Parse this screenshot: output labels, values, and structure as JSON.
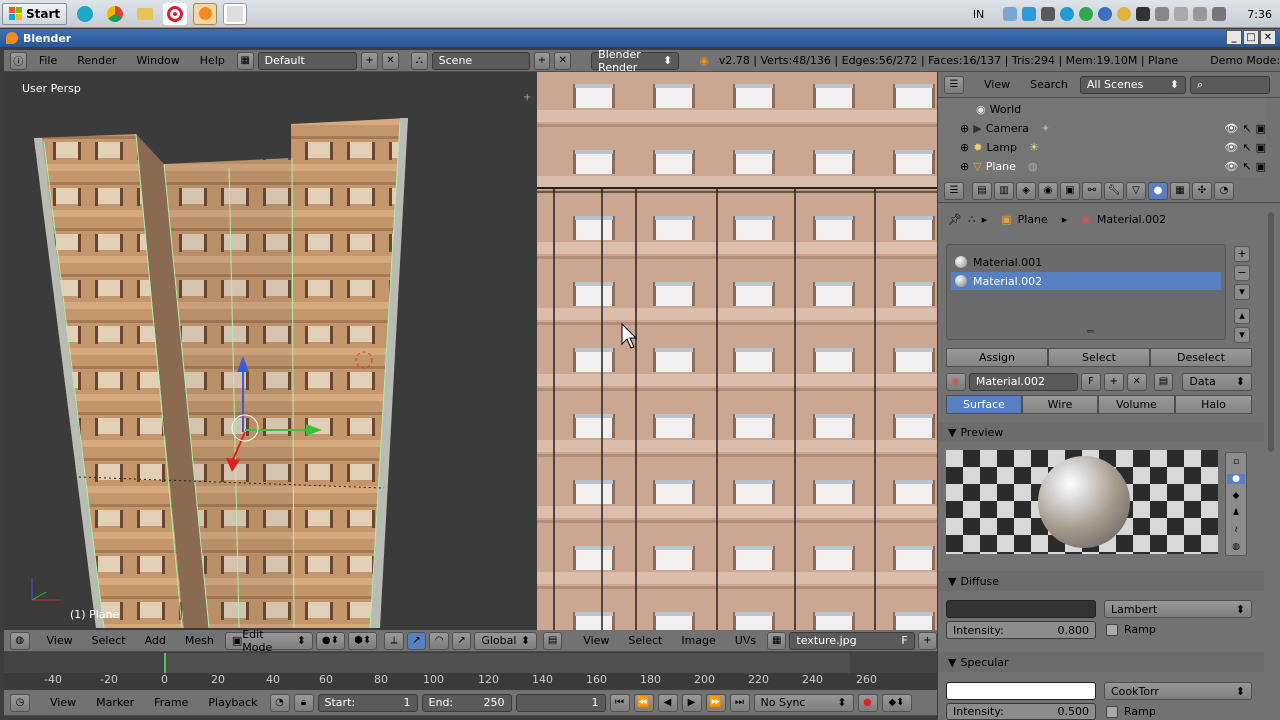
{
  "taskbar": {
    "start_label": "Start",
    "apps": [
      "chrome-icon",
      "chrome-icon",
      "folder-icon",
      "opera-icon",
      "blender-icon",
      "window-icon"
    ],
    "lang": "IN",
    "clock": "7:36"
  },
  "window": {
    "title": "Blender"
  },
  "top_header": {
    "menus": [
      "File",
      "Render",
      "Window",
      "Help"
    ],
    "layout": "Default",
    "scene": "Scene",
    "engine": "Blender Render",
    "stats": "v2.78 | Verts:48/136 | Edges:56/272 | Faces:16/137 | Tris:294 | Mem:19.10M | Plane",
    "demo": "Demo Mode:"
  },
  "viewport": {
    "persp_label": "User Persp",
    "object_label": "(1) Plane",
    "header": {
      "menus": [
        "View",
        "Select",
        "Add",
        "Mesh"
      ],
      "mode": "Edit Mode",
      "orientation": "Global"
    }
  },
  "uv_editor": {
    "header": {
      "menus": [
        "View",
        "Select",
        "Image",
        "UVs"
      ],
      "image_name": "texture.jpg",
      "fake_user": "F"
    }
  },
  "timeline": {
    "ticks": [
      "-40",
      "-20",
      "0",
      "20",
      "40",
      "60",
      "80",
      "100",
      "120",
      "140",
      "160",
      "180",
      "200",
      "220",
      "240",
      "260"
    ],
    "menus": [
      "View",
      "Marker",
      "Frame",
      "Playback"
    ],
    "start_label": "Start:",
    "start_value": "1",
    "end_label": "End:",
    "end_value": "250",
    "current_frame": "1",
    "sync": "No Sync"
  },
  "outliner": {
    "menus": [
      "View",
      "Search"
    ],
    "scenes_dropdown": "All Scenes",
    "items": [
      {
        "label": "World"
      },
      {
        "label": "Camera"
      },
      {
        "label": "Lamp"
      },
      {
        "label": "Plane"
      }
    ]
  },
  "properties": {
    "breadcrumb": {
      "object": "Plane",
      "material": "Material.002"
    },
    "slots": [
      "Material.001",
      "Material.002"
    ],
    "assign": "Assign",
    "select": "Select",
    "deselect": "Deselect",
    "material_name": "Material.002",
    "fake_user": "F",
    "link": "Data",
    "tabs": [
      "Surface",
      "Wire",
      "Volume",
      "Halo"
    ],
    "preview_label": "Preview",
    "diffuse_label": "Diffuse",
    "diffuse_shader": "Lambert",
    "intensity_label": "Intensity:",
    "intensity_value": "0.800",
    "ramp_label": "Ramp",
    "specular_label": "Specular",
    "specular_shader": "CookTorr",
    "spec_intensity_label": "Intensity:",
    "spec_intensity_value": "0.500",
    "spec_ramp_label": "Ramp"
  },
  "colors": {
    "accent": "#5680c2",
    "title_bar": "#2b5796"
  }
}
